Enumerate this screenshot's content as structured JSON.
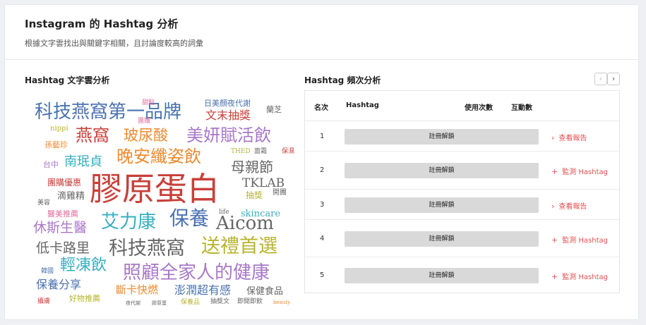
{
  "header": {
    "title": "Instagram 的 Hashtag 分析",
    "subtitle": "根據文字雲找出與關鍵字相關，且討論度較高的詞彙"
  },
  "wordcloud": {
    "title": "Hashtag 文字雲分析",
    "words": [
      "科技燕窩第一品牌",
      "日美顏夜代謝",
      "甜點",
      "蘭芝",
      "團購",
      "文末抽獎",
      "nippi",
      "燕窩",
      "玻尿酸",
      "美妍賦活飲",
      "孫藝珍",
      "THED",
      "面霜",
      "保濕",
      "南珉貞",
      "晚安纖姿飲",
      "台中",
      "母親節",
      "團購優惠",
      "膠原蛋白",
      "TKLAB",
      "滴雞精",
      "抽獎",
      "開團",
      "美容",
      "醫美推薦",
      "life",
      "skincare",
      "休斯生醫",
      "艾力康",
      "保養",
      "Aicom",
      "低卡路里",
      "科技燕窩",
      "送禮首選",
      "輕凍飲",
      "照顧全家人的健康",
      "韓國",
      "保養分享",
      "斷卡快燃",
      "澎潤超有感",
      "保健食品",
      "好物推薦",
      "攝膚",
      "夜代謝",
      "膠原蛋",
      "保養品",
      "抽獎文",
      "即開即飲",
      "beauty"
    ],
    "colors": {
      "blue": "#4a72b0",
      "red": "#c8403a",
      "orange": "#ef8a2e",
      "purple": "#a878c8",
      "teal": "#37aec0",
      "olive": "#b8b430",
      "gray": "#666666",
      "pink": "#e0709c"
    }
  },
  "freq": {
    "title": "Hashtag 頻次分析",
    "prev_icon": "‹",
    "next_icon": "›",
    "columns": {
      "rank": "名次",
      "hashtag": "Hashtag",
      "uses": "使用次數",
      "engagement": "互動數"
    },
    "rows": [
      {
        "rank": "1",
        "bar": "註冊解鎖",
        "action_icon": "›",
        "action": "查看報告"
      },
      {
        "rank": "2",
        "bar": "註冊解鎖",
        "action_icon": "+",
        "action": "監測 Hashtag"
      },
      {
        "rank": "3",
        "bar": "註冊解鎖",
        "action_icon": "›",
        "action": "查看報告"
      },
      {
        "rank": "4",
        "bar": "註冊解鎖",
        "action_icon": "+",
        "action": "監測 Hashtag"
      },
      {
        "rank": "5",
        "bar": "註冊解鎖",
        "action_icon": "+",
        "action": "監測 Hashtag"
      }
    ]
  }
}
